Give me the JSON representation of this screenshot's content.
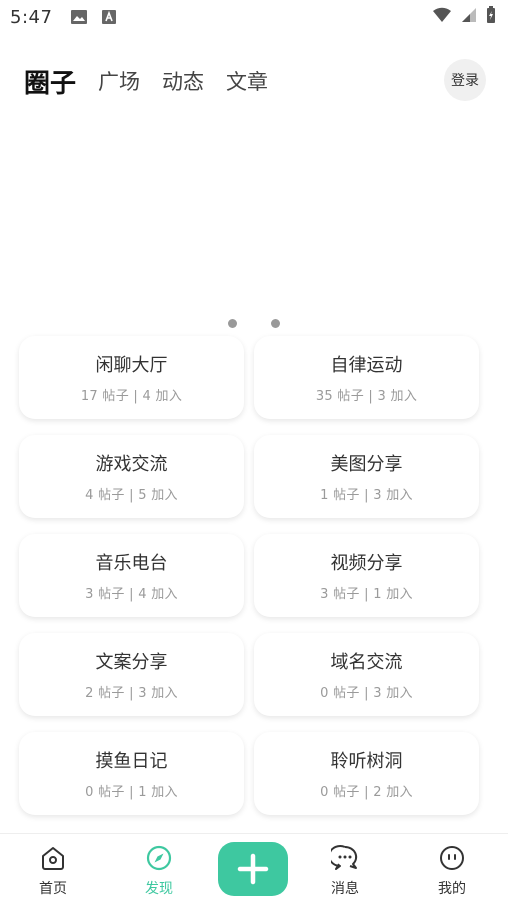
{
  "status_bar": {
    "time": "5:47"
  },
  "header": {
    "tabs": [
      {
        "label": "圈子",
        "active": true
      },
      {
        "label": "广场",
        "active": false
      },
      {
        "label": "动态",
        "active": false
      },
      {
        "label": "文章",
        "active": false
      }
    ],
    "login_label": "登录"
  },
  "banner": {
    "page_dots": 2
  },
  "circles": [
    {
      "name": "闲聊大厅",
      "meta": "17 帖子 | 4 加入"
    },
    {
      "name": "自律运动",
      "meta": "35 帖子 | 3 加入"
    },
    {
      "name": "游戏交流",
      "meta": "4 帖子 | 5 加入"
    },
    {
      "name": "美图分享",
      "meta": "1 帖子 | 3 加入"
    },
    {
      "name": "音乐电台",
      "meta": "3 帖子 | 4 加入"
    },
    {
      "name": "视频分享",
      "meta": "3 帖子 | 1 加入"
    },
    {
      "name": "文案分享",
      "meta": "2 帖子 | 3 加入"
    },
    {
      "name": "域名交流",
      "meta": "0 帖子 | 3 加入"
    },
    {
      "name": "摸鱼日记",
      "meta": "0 帖子 | 1 加入"
    },
    {
      "name": "聆听树洞",
      "meta": "0 帖子 | 2 加入"
    }
  ],
  "bottom_nav": {
    "items": [
      {
        "label": "首页",
        "icon": "home-icon",
        "active": false
      },
      {
        "label": "发现",
        "icon": "compass-icon",
        "active": true
      },
      {
        "label": "",
        "icon": "plus-icon",
        "active": false
      },
      {
        "label": "消息",
        "icon": "chat-icon",
        "active": false
      },
      {
        "label": "我的",
        "icon": "face-icon",
        "active": false
      }
    ]
  },
  "colors": {
    "accent": "#3ec8a0"
  }
}
